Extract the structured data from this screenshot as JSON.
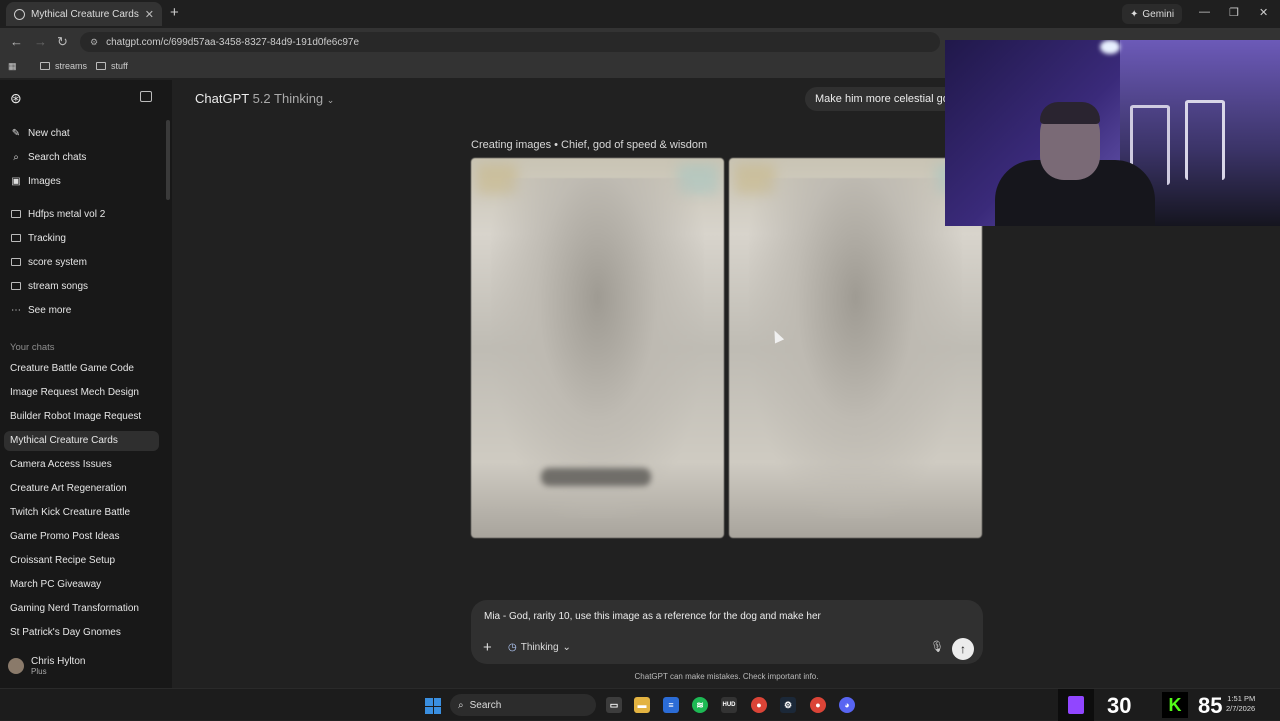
{
  "browser": {
    "tab_title": "Mythical Creature Cards",
    "tab_close": "✕",
    "new_tab": "+",
    "gemini_label": "Gemini",
    "url": "chatgpt.com/c/699d57aa-3458-8327-84d9-191d0fe6c97e",
    "bookmarks": [
      "streams",
      "stuff"
    ]
  },
  "sidebar": {
    "nav": [
      {
        "label": "New chat",
        "icon": "new-chat-icon",
        "glyph": "✎"
      },
      {
        "label": "Search chats",
        "icon": "search-icon",
        "glyph": "⌕"
      },
      {
        "label": "Images",
        "icon": "images-icon",
        "glyph": "▣"
      }
    ],
    "projects": [
      {
        "label": "Hdfps metal vol 2",
        "icon": "folder-icon"
      },
      {
        "label": "Tracking",
        "icon": "folder-icon"
      },
      {
        "label": "score system",
        "icon": "folder-icon"
      },
      {
        "label": "stream songs",
        "icon": "folder-icon"
      },
      {
        "label": "See more",
        "icon": "more-icon"
      }
    ],
    "section_label": "Your chats",
    "chats": [
      "Creature Battle Game Code",
      "Image Request Mech Design",
      "Builder Robot Image Request",
      "Mythical Creature Cards",
      "Camera Access Issues",
      "Creature Art Regeneration",
      "Twitch Kick Creature Battle",
      "Game Promo Post Ideas",
      "Croissant Recipe Setup",
      "March PC Giveaway",
      "Gaming Nerd Transformation",
      "St Patrick's Day Gnomes"
    ],
    "active_chat": "Mythical Creature Cards",
    "user": {
      "name": "Chris Hylton",
      "plan": "Plus"
    }
  },
  "main": {
    "model_name": "ChatGPT",
    "model_version": "5.2 Thinking",
    "user_message": "Make him more celestial go",
    "status": "Creating images • Chief, god of speed & wisdom",
    "composer_text": "Mia - God, rarity 10, use this image as a reference for the dog and make her",
    "mode_label": "Thinking",
    "disclaimer": "ChatGPT can make mistakes. Check important info."
  },
  "taskbar": {
    "search_label": "Search",
    "twitch_viewers": "30",
    "kick_viewers": "85",
    "time": "1:51 PM",
    "date": "2/7/2026"
  },
  "colors": {
    "twitch": "#9146ff",
    "kick": "#53fc18",
    "windows_blue": "#3a8fe0"
  }
}
